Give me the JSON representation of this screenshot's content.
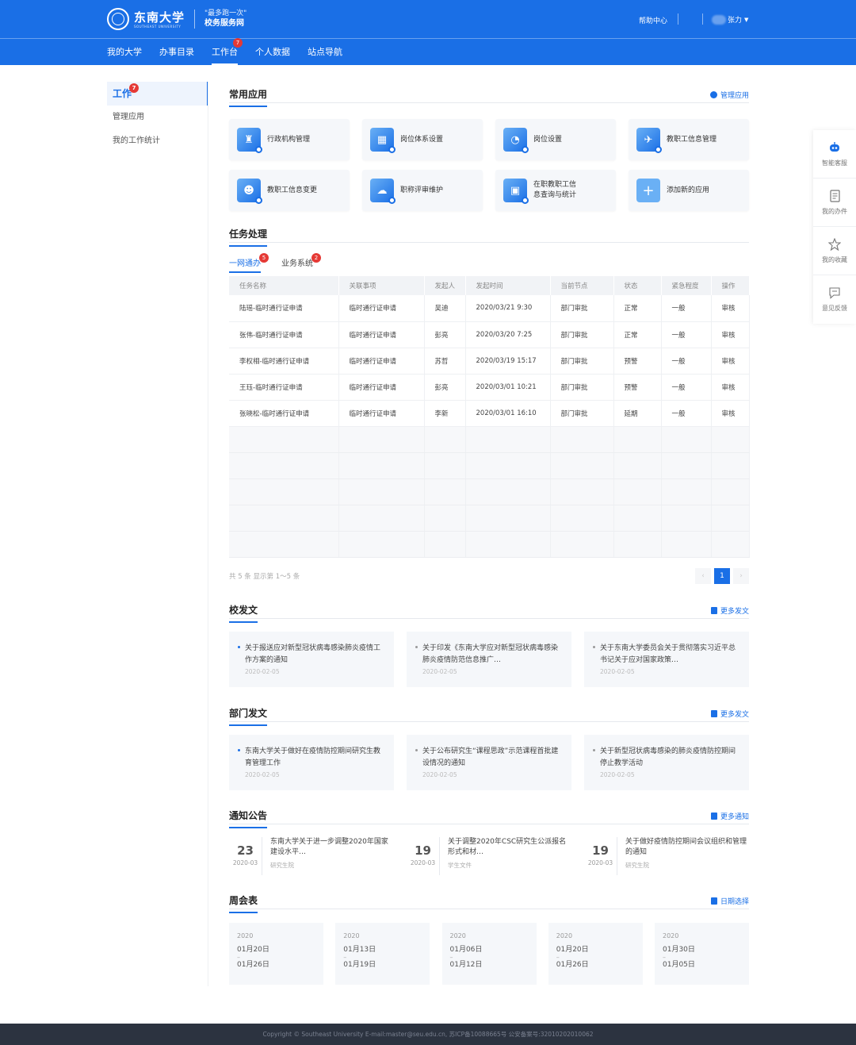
{
  "header": {
    "university_cn": "东南大学",
    "university_en": "SOUTHEAST UNIVERSITY",
    "slogan_top": "\"最多跑一次\"",
    "slogan_bottom": "校务服务网",
    "help": "帮助中心",
    "user_name": "张力",
    "nav": [
      {
        "label": "我的大学"
      },
      {
        "label": "办事目录"
      },
      {
        "label": "工作台",
        "badge": "7"
      },
      {
        "label": "个人数据"
      },
      {
        "label": "站点导航"
      }
    ]
  },
  "sidebar": {
    "items": [
      {
        "label": "工作",
        "badge": "7"
      },
      {
        "label": "管理应用"
      },
      {
        "label": "我的工作统计"
      }
    ]
  },
  "apps": {
    "title": "常用应用",
    "manage_link": "管理应用",
    "items": [
      {
        "label": "行政机构管理",
        "icon": "admin-org-icon"
      },
      {
        "label": "岗位体系设置",
        "icon": "job-system-icon"
      },
      {
        "label": "岗位设置",
        "icon": "position-icon"
      },
      {
        "label": "教职工信息管理",
        "icon": "staff-info-icon"
      },
      {
        "label": "教职工信息变更",
        "icon": "staff-change-icon"
      },
      {
        "label": "职称评审维护",
        "icon": "title-review-icon"
      },
      {
        "label": "在职教职工信\n息查询与统计",
        "icon": "staff-query-icon"
      },
      {
        "label": "添加新的应用",
        "icon": "plus-icon"
      }
    ]
  },
  "tasks": {
    "title": "任务处理",
    "tabs": [
      {
        "label": "一网通办",
        "badge": "5"
      },
      {
        "label": "业务系统",
        "badge": "2"
      }
    ],
    "columns": [
      "任务名称",
      "关联事项",
      "发起人",
      "发起时间",
      "当前节点",
      "状态",
      "紧急程度",
      "操作"
    ],
    "rows": [
      {
        "name": "陆瑶-临时通行证申请",
        "item": "临时通行证申请",
        "initiator": "吴迪",
        "time": "2020/03/21 9:30",
        "node": "部门审批",
        "status": "正常",
        "status_type": "normal",
        "urgency": "一般",
        "action": "审核"
      },
      {
        "name": "张伟-临时通行证申请",
        "item": "临时通行证申请",
        "initiator": "彭亮",
        "time": "2020/03/20 7:25",
        "node": "部门审批",
        "status": "正常",
        "status_type": "normal",
        "urgency": "一般",
        "action": "审核"
      },
      {
        "name": "李权相-临时通行证申请",
        "item": "临时通行证申请",
        "initiator": "苏哲",
        "time": "2020/03/19 15:17",
        "node": "部门审批",
        "status": "预警",
        "status_type": "warn",
        "urgency": "一般",
        "action": "审核"
      },
      {
        "name": "王珏-临时通行证申请",
        "item": "临时通行证申请",
        "initiator": "彭亮",
        "time": "2020/03/01 10:21",
        "node": "部门审批",
        "status": "预警",
        "status_type": "warn",
        "urgency": "一般",
        "action": "审核"
      },
      {
        "name": "张晓松-临时通行证申请",
        "item": "临时通行证申请",
        "initiator": "李新",
        "time": "2020/03/01 16:10",
        "node": "部门审批",
        "status": "延期",
        "status_type": "late",
        "urgency": "一般",
        "action": "审核"
      }
    ],
    "pager_info": "共 5 条  显示第 1～5 条",
    "pager_prev": "‹",
    "pager_current": "1",
    "pager_next": "›"
  },
  "school_docs": {
    "title": "校发文",
    "more": "更多发文",
    "items": [
      {
        "title": "关于报送应对新型冠状病毒感染肺炎疫情工作方案的通知",
        "date": "2020-02-05"
      },
      {
        "title": "关于印发《东南大学应对新型冠状病毒感染肺炎疫情防范信息推广…",
        "date": "2020-02-05"
      },
      {
        "title": "关于东南大学委员会关于贯彻落实习近平总书记关于应对国家政策…",
        "date": "2020-02-05"
      }
    ]
  },
  "dept_docs": {
    "title": "部门发文",
    "more": "更多发文",
    "items": [
      {
        "title": "东南大学关于做好在疫情防控期间研究生教育管理工作",
        "date": "2020-02-05"
      },
      {
        "title": "关于公布研究生“课程思政”示范课程首批建设情况的通知",
        "date": "2020-02-05"
      },
      {
        "title": "关于新型冠状病毒感染的肺炎疫情防控期间停止教学活动",
        "date": "2020-02-05"
      }
    ]
  },
  "notices": {
    "title": "通知公告",
    "more": "更多通知",
    "items": [
      {
        "day": "23",
        "ym": "2020-03",
        "title": "东南大学关于进一步调整2020年国家建设水平…",
        "source": "研究生院"
      },
      {
        "day": "19",
        "ym": "2020-03",
        "title": "关于调整2020年CSC研究生公派报名形式和材…",
        "source": "学生文件"
      },
      {
        "day": "19",
        "ym": "2020-03",
        "title": "关于做好疫情防控期间会议组织和管理的通知",
        "source": "研究生院"
      }
    ]
  },
  "weekly": {
    "title": "周会表",
    "date_select": "日期选择",
    "items": [
      {
        "year": "2020",
        "start": "01月20日",
        "dash": "–",
        "end": "01月26日"
      },
      {
        "year": "2020",
        "start": "01月13日",
        "dash": "–",
        "end": "01月19日"
      },
      {
        "year": "2020",
        "start": "01月06日",
        "dash": "–",
        "end": "01月12日"
      },
      {
        "year": "2020",
        "start": "01月20日",
        "dash": "–",
        "end": "01月26日"
      },
      {
        "year": "2020",
        "start": "01月30日",
        "dash": "–",
        "end": "01月05日"
      }
    ]
  },
  "float_panel": {
    "items": [
      {
        "label": "智能客服",
        "icon": "robot-icon"
      },
      {
        "label": "我的办件",
        "icon": "document-icon"
      },
      {
        "label": "我的收藏",
        "icon": "star-icon"
      },
      {
        "label": "意见反馈",
        "icon": "feedback-icon"
      }
    ]
  },
  "footer": {
    "text": "Copyright © Southeast University E-mail:master@seu.edu.cn,  苏ICP备10088665号    公安备案号:32010202010062"
  },
  "colors": {
    "brand": "#1a6fe6",
    "badge": "#e53935",
    "warn": "#f5a623",
    "late": "#e8562a",
    "footer_bg": "#2c3340"
  }
}
